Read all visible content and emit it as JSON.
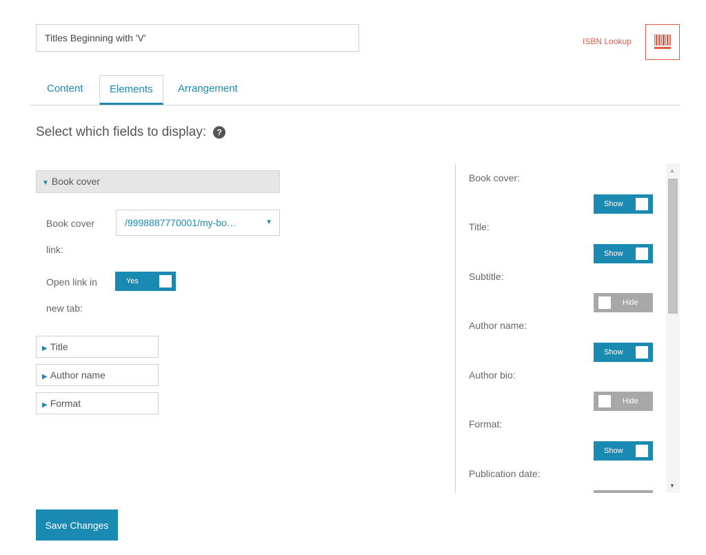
{
  "title_field": {
    "value": "Titles Beginning with 'V'"
  },
  "isbn": {
    "label": "ISBN Lookup",
    "barcode_icon": "barcode-icon"
  },
  "tabs": [
    {
      "label": "Content",
      "active": false
    },
    {
      "label": "Elements",
      "active": true
    },
    {
      "label": "Arrangement",
      "active": false
    }
  ],
  "heading": "Select which fields to display:",
  "help_icon": {
    "name": "question-circle-icon",
    "glyph": "?"
  },
  "left": {
    "open_section": {
      "label": "Book cover",
      "indicator": "▼"
    },
    "book_cover_link": {
      "label_line1": "Book cover",
      "label_line2": "link:",
      "value": "/9998887770001/my-bo…",
      "caret": "▼"
    },
    "open_in_new_tab": {
      "label_line1": "Open link in",
      "label_line2": "new tab:",
      "toggle": "Yes"
    },
    "collapsed_sections": [
      {
        "label": "Title",
        "indicator": "▶"
      },
      {
        "label": "Author name",
        "indicator": "▶"
      },
      {
        "label": "Format",
        "indicator": "▶"
      }
    ]
  },
  "right": {
    "fields": [
      {
        "label": "Book cover:",
        "state": "Show"
      },
      {
        "label": "Title:",
        "state": "Show"
      },
      {
        "label": "Subtitle:",
        "state": "Hide"
      },
      {
        "label": "Author name:",
        "state": "Show"
      },
      {
        "label": "Author bio:",
        "state": "Hide"
      },
      {
        "label": "Format:",
        "state": "Show"
      },
      {
        "label": "Publication date:",
        "state": "Hide"
      }
    ]
  },
  "save_button": "Save Changes",
  "colors": {
    "accent": "#1a8ab3",
    "isbn": "#e15a48",
    "hide": "#a8a8a8"
  }
}
